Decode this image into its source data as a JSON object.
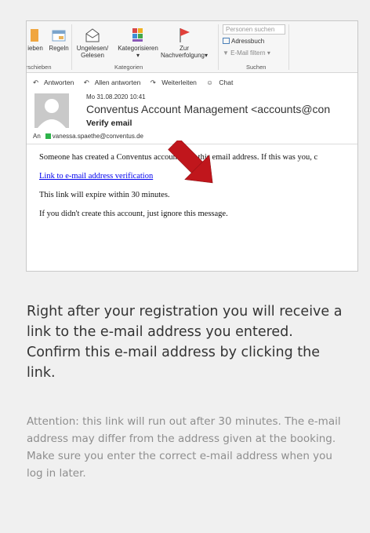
{
  "ribbon": {
    "move_label": "ieben",
    "rules_label": "Regeln",
    "unread_label": "Ungelesen/",
    "read_label": "Gelesen",
    "categorize_label": "Kategorisieren",
    "followup_top": "Zur",
    "followup_bottom": "Nachverfolgung",
    "search_placeholder": "Personen suchen",
    "address_book": "Adressbuch",
    "filter_email": "E-Mail filtern",
    "group_move": "rschieben",
    "group_categories": "Kategorien",
    "group_search": "Suchen"
  },
  "actions": {
    "reply": "Antworten",
    "reply_all": "Allen antworten",
    "forward": "Weiterleiten",
    "chat": "Chat"
  },
  "email": {
    "date": "Mo 31.08.2020 10:41",
    "sender": "Conventus Account Management <accounts@con",
    "subject": "Verify email",
    "to_label": "An",
    "to_address": "vanessa.spaethe@conventus.de",
    "body_line1": "Someone has created a Conventus account with this email address. If this was you, c",
    "link_text": "Link to e-mail address verification",
    "body_line2": "This link will expire within 30 minutes.",
    "body_line3": "If you didn't create this account, just ignore this message."
  },
  "caption": "Right after your registration you will receive a link to the e-mail address you entered. Confirm this e-mail address by clicking the link.",
  "note": "Attention: this link will run out after 30 minutes. The e-mail address may differ from the address given at the booking. Make sure you enter the correct e-mail address when you log in later.",
  "colors": {
    "arrow": "#c0161c",
    "link": "#0000ee",
    "recipient_status": "#2db34a",
    "flag": "#e0403a"
  }
}
